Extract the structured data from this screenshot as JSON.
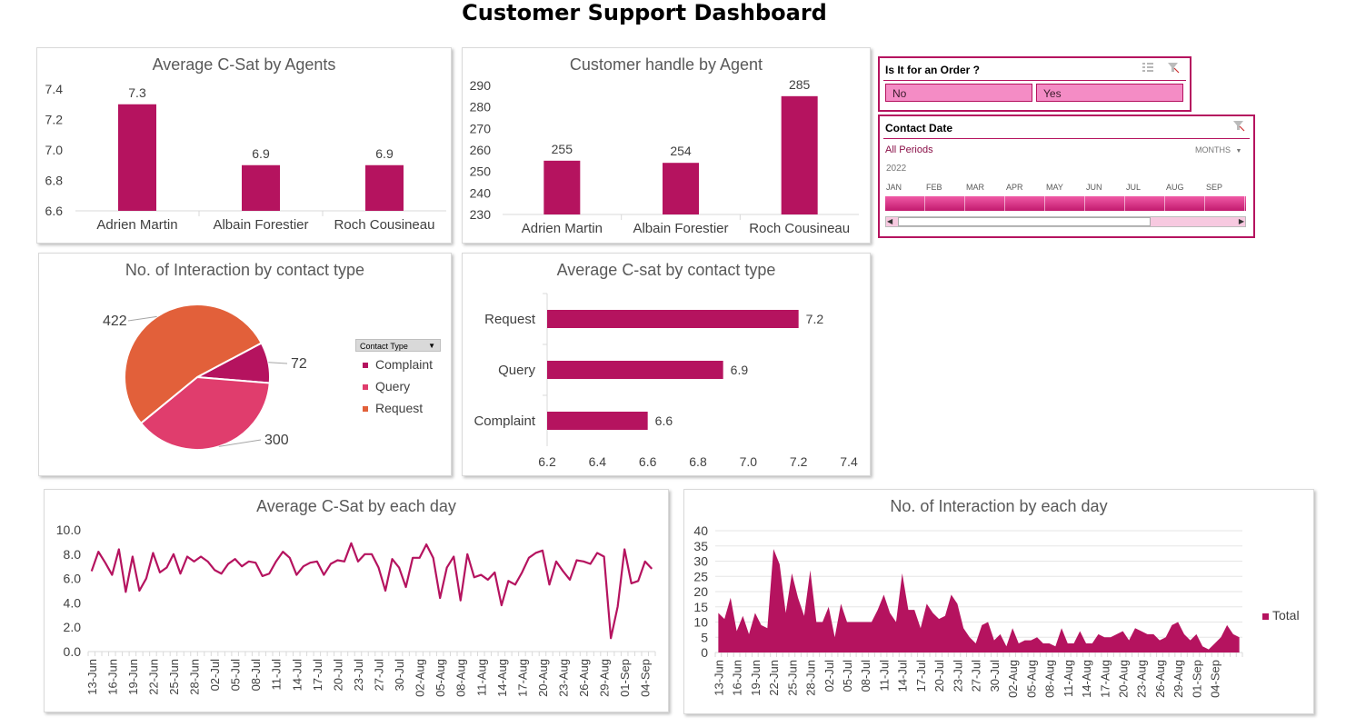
{
  "page_title": "Customer Support Dashboard",
  "colors": {
    "primary": "#b5135f",
    "pie_request": "#e2603a",
    "pie_query": "#e03d6d",
    "pie_complaint": "#b5135f",
    "slicer_fill": "#f48cc5"
  },
  "slicer_order": {
    "title": "Is It for an Order ?",
    "options": [
      "No",
      "Yes"
    ],
    "icons": [
      "multi-select-icon",
      "clear-filter-icon"
    ]
  },
  "slicer_date": {
    "title": "Contact Date",
    "period_label": "All Periods",
    "level_label": "MONTHS",
    "year": "2022",
    "months": [
      "JAN",
      "FEB",
      "MAR",
      "APR",
      "MAY",
      "JUN",
      "JUL",
      "AUG",
      "SEP"
    ]
  },
  "chart_data": [
    {
      "id": "csat_agents",
      "type": "bar",
      "title": "Average C-Sat by Agents",
      "categories": [
        "Adrien Martin",
        "Albain Forestier",
        "Roch Cousineau"
      ],
      "values": [
        7.3,
        6.9,
        6.9
      ],
      "data_labels": [
        "7.3",
        "6.9",
        "6.9"
      ],
      "ylim": [
        6.6,
        7.4
      ],
      "yticks": [
        "6.6",
        "6.8",
        "7.0",
        "7.2",
        "7.4"
      ]
    },
    {
      "id": "handled_agents",
      "type": "bar",
      "title": "Customer handle by Agent",
      "categories": [
        "Adrien Martin",
        "Albain Forestier",
        "Roch Cousineau"
      ],
      "values": [
        255,
        254,
        285
      ],
      "data_labels": [
        "255",
        "254",
        "285"
      ],
      "ylim": [
        230,
        290
      ],
      "yticks": [
        "230",
        "240",
        "250",
        "260",
        "270",
        "280",
        "290"
      ]
    },
    {
      "id": "interactions_type",
      "type": "pie",
      "title": "No. of Interaction by contact type",
      "legend_title": "Contact Type",
      "categories": [
        "Complaint",
        "Query",
        "Request"
      ],
      "values": [
        72,
        300,
        422
      ],
      "data_labels": [
        "72",
        "300",
        "422"
      ]
    },
    {
      "id": "csat_type",
      "type": "bar",
      "orientation": "horizontal",
      "title": "Average C-sat by contact type",
      "categories": [
        "Request",
        "Query",
        "Complaint"
      ],
      "values": [
        7.2,
        6.9,
        6.6
      ],
      "data_labels": [
        "7.2",
        "6.9",
        "6.6"
      ],
      "xlim": [
        6.2,
        7.4
      ],
      "xticks": [
        "6.2",
        "6.4",
        "6.6",
        "6.8",
        "7.0",
        "7.2",
        "7.4"
      ]
    },
    {
      "id": "csat_day",
      "type": "line",
      "title": "Average C-Sat by each day",
      "ylim": [
        0,
        10
      ],
      "yticks": [
        "0.0",
        "2.0",
        "4.0",
        "6.0",
        "8.0",
        "10.0"
      ],
      "x_labels": [
        "13-Jun",
        "16-Jun",
        "19-Jun",
        "22-Jun",
        "25-Jun",
        "28-Jun",
        "02-Jul",
        "05-Jul",
        "08-Jul",
        "11-Jul",
        "14-Jul",
        "17-Jul",
        "20-Jul",
        "23-Jul",
        "27-Jul",
        "30-Jul",
        "02-Aug",
        "05-Aug",
        "08-Aug",
        "11-Aug",
        "14-Aug",
        "17-Aug",
        "20-Aug",
        "23-Aug",
        "26-Aug",
        "29-Aug",
        "01-Sep",
        "04-Sep"
      ],
      "values": [
        6.6,
        8.2,
        7.3,
        6.3,
        8.4,
        4.9,
        7.8,
        5.0,
        6.0,
        8.1,
        6.5,
        6.9,
        8.0,
        6.4,
        7.8,
        7.4,
        7.8,
        7.4,
        6.7,
        6.4,
        7.2,
        7.6,
        7.0,
        7.4,
        7.3,
        6.2,
        6.4,
        7.4,
        8.2,
        7.7,
        6.3,
        7.0,
        7.3,
        7.4,
        6.3,
        7.2,
        7.5,
        7.4,
        8.9,
        7.4,
        8.0,
        8.0,
        6.9,
        5.0,
        7.6,
        6.9,
        5.3,
        7.7,
        7.7,
        8.8,
        7.7,
        4.4,
        6.9,
        7.8,
        4.2,
        8.0,
        6.1,
        6.3,
        5.9,
        6.5,
        3.8,
        5.8,
        5.5,
        6.5,
        7.7,
        8.1,
        8.3,
        5.5,
        7.4,
        6.6,
        5.9,
        7.5,
        7.4,
        7.2,
        8.1,
        7.8,
        1.1,
        3.7,
        8.4,
        5.6,
        5.8,
        7.4,
        6.8
      ]
    },
    {
      "id": "interactions_day",
      "type": "area",
      "title": "No. of Interaction by each day",
      "legend": [
        "Total"
      ],
      "ylim": [
        0,
        40
      ],
      "yticks": [
        "0",
        "5",
        "10",
        "15",
        "20",
        "25",
        "30",
        "35",
        "40"
      ],
      "x_labels": [
        "13-Jun",
        "16-Jun",
        "19-Jun",
        "22-Jun",
        "25-Jun",
        "28-Jun",
        "02-Jul",
        "05-Jul",
        "08-Jul",
        "11-Jul",
        "14-Jul",
        "17-Jul",
        "20-Jul",
        "23-Jul",
        "27-Jul",
        "30-Jul",
        "02-Aug",
        "05-Aug",
        "08-Aug",
        "11-Aug",
        "14-Aug",
        "17-Aug",
        "20-Aug",
        "23-Aug",
        "26-Aug",
        "29-Aug",
        "01-Sep",
        "04-Sep"
      ],
      "values": [
        13,
        11,
        18,
        7,
        12,
        6,
        13,
        9,
        8,
        34,
        29,
        13,
        26,
        18,
        12,
        27,
        10,
        10,
        15,
        5,
        16,
        10,
        10,
        10,
        10,
        10,
        14,
        19,
        13,
        10,
        26,
        14,
        14,
        8,
        16,
        13,
        11,
        12,
        19,
        16,
        8,
        5,
        3,
        9,
        10,
        4,
        6,
        2,
        8,
        3,
        4,
        4,
        5,
        3,
        3,
        2,
        8,
        3,
        3,
        7,
        3,
        3,
        6,
        5,
        5,
        6,
        7,
        4,
        8,
        7,
        6,
        6,
        4,
        5,
        9,
        10,
        6,
        4,
        6,
        2,
        1,
        3,
        5,
        9,
        6,
        5
      ]
    }
  ]
}
